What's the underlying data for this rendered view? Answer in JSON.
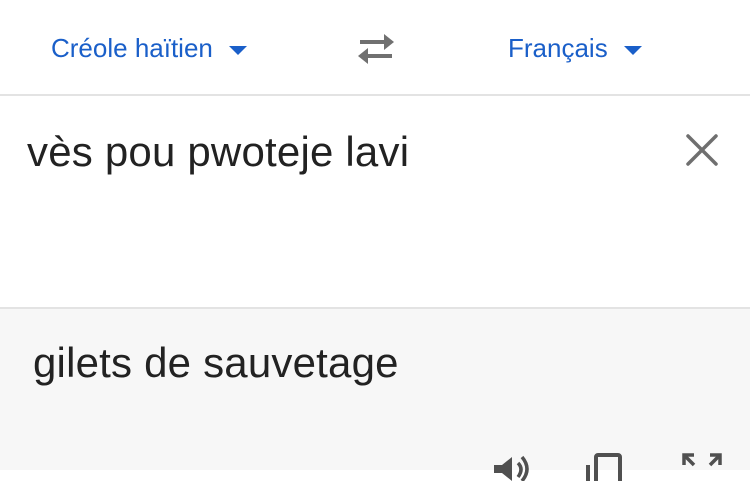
{
  "languages": {
    "source": "Créole haïtien",
    "target": "Français"
  },
  "icons": {
    "source_dropdown": "chevron-down-icon",
    "target_dropdown": "chevron-down-icon",
    "swap": "swap-languages-icon",
    "clear": "close-icon",
    "speaker": "speaker-icon",
    "copy": "copy-icon",
    "expand": "expand-icon"
  },
  "input": {
    "text": "vès pou pwoteje lavi"
  },
  "output": {
    "text": "gilets de sauvetage"
  },
  "colors": {
    "accent": "#1a5fc9",
    "icon_gray": "#707070",
    "text": "#222222",
    "output_bg": "#f7f7f7",
    "divider": "#e3e3e3"
  }
}
